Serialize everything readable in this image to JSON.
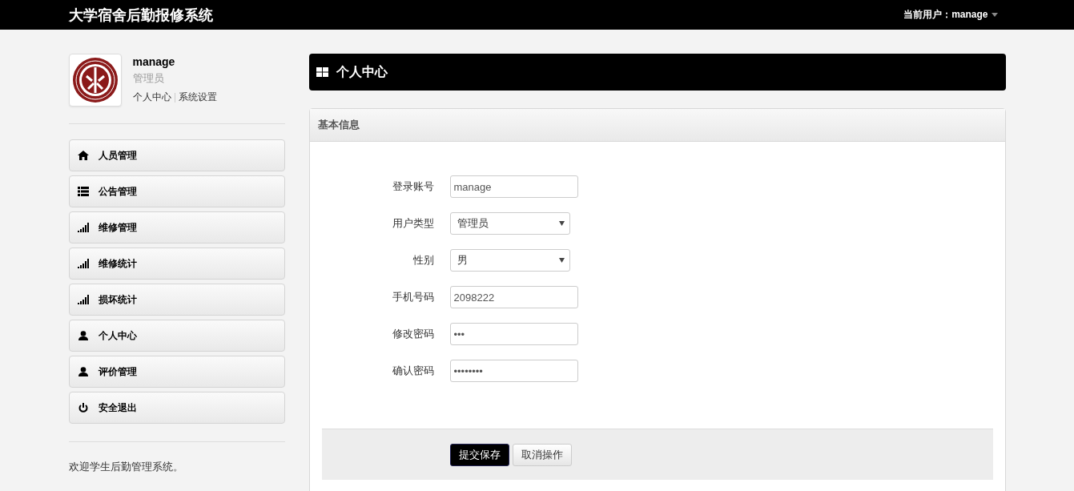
{
  "navbar": {
    "brand": "大学宿舍后勤报修系统",
    "user_label": "当前用户：manage"
  },
  "profile": {
    "name": "manage",
    "role": "管理员",
    "links": [
      "个人中心",
      "系统设置"
    ]
  },
  "menu": [
    {
      "label": "人员管理",
      "kind": "home"
    },
    {
      "label": "公告管理",
      "kind": "list"
    },
    {
      "label": "维修管理",
      "kind": "signal"
    },
    {
      "label": "维修统计",
      "kind": "signal"
    },
    {
      "label": "损坏统计",
      "kind": "signal"
    },
    {
      "label": "个人中心",
      "kind": "user"
    },
    {
      "label": "评价管理",
      "kind": "user"
    },
    {
      "label": "安全退出",
      "kind": "power"
    }
  ],
  "sidebar_footer": "欢迎学生后勤管理系统。",
  "page_title": "个人中心",
  "panel": {
    "title": "基本信息",
    "fields": [
      {
        "label": "登录账号",
        "kind": "text",
        "value": "manage"
      },
      {
        "label": "用户类型",
        "kind": "select",
        "value": "管理员"
      },
      {
        "label": "性别",
        "kind": "select",
        "value": "男"
      },
      {
        "label": "手机号码",
        "kind": "text",
        "value": "2098222"
      },
      {
        "label": "修改密码",
        "kind": "password",
        "value": "•••"
      },
      {
        "label": "确认密码",
        "kind": "password",
        "value": "••••••••"
      }
    ],
    "buttons": [
      {
        "label": "提交保存",
        "kind": "primary"
      },
      {
        "label": "取消操作",
        "kind": "default"
      }
    ]
  }
}
